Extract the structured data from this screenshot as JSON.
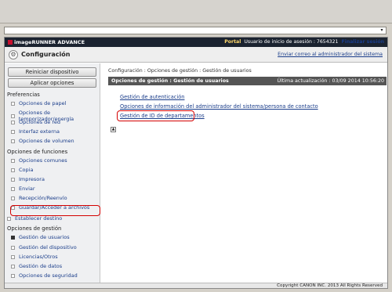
{
  "browser": {
    "dropdown_icon": "chevron-down-icon"
  },
  "topbar": {
    "brand": "imageRUNNER ADVANCE",
    "portal": "Portal",
    "user_label": "Usuario de inicio de asesión : 7654321",
    "logout": "Finalizar sesión"
  },
  "confbar": {
    "title": "Configuración",
    "send_mail": "Enviar correo al administrador del sistema",
    "icon": "settings-icon"
  },
  "sidebar": {
    "restart_button": "Reiniciar dispositivo",
    "apply_button": "Aplicar opciones",
    "sections": [
      {
        "title": "Preferencias",
        "items": [
          "Opciones de papel",
          "Opciones de temporizador/energía",
          "Opciones de red",
          "Interfaz externa",
          "Opciones de volumen"
        ]
      },
      {
        "title": "Opciones de funciones",
        "items": [
          "Opciones comunes",
          "Copia",
          "Impresora",
          "Enviar",
          "Recepción/Reenvío",
          "Guardar/Acceder a archivos"
        ]
      }
    ],
    "establish_dest": "Establecer destino",
    "mgmt_title": "Opciones de gestión",
    "mgmt_items": [
      "Gestión de usuarios",
      "Gestión del dispositivo",
      "Licencias/Otros",
      "Gestión de datos",
      "Opciones de seguridad"
    ]
  },
  "content": {
    "breadcrumb": "Configuración : Opciones de gestión : Gestión de usuarios",
    "panel_title": "Opciones de gestión : Gestión de usuarios",
    "last_update": "Última actualización : 03/09 2014 10:56:20",
    "links": [
      "Gestión de autenticación",
      "Opciones de información del administrador del sistema/persona de contacto",
      "Gestión de ID de departamentos"
    ]
  },
  "footer": {
    "copyright": "Copyright CANON INC. 2013 All Rights Reserved"
  },
  "colors": {
    "highlight": "#d40000",
    "topbar": "#1b2330",
    "link": "#1a3d8a"
  }
}
